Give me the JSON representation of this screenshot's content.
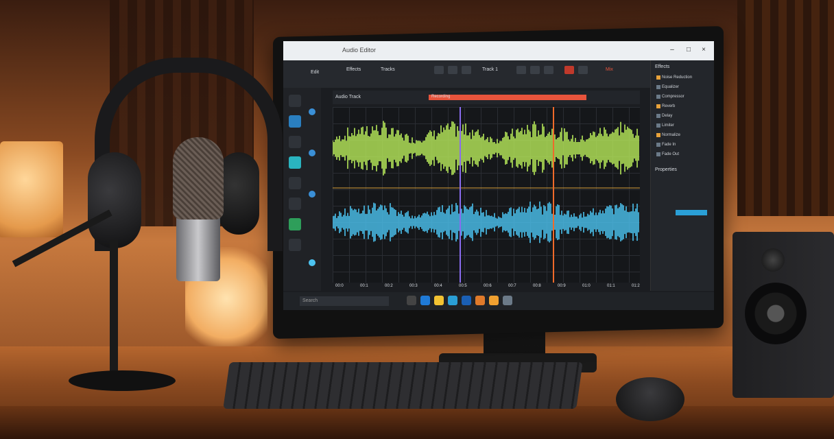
{
  "app": {
    "title": "Audio Editor",
    "toolbar_labels": [
      "Edit",
      "Effects",
      "Tracks",
      "Track 1",
      "Mix"
    ],
    "timeline_bar_label": "Recording",
    "track_label": "Audio Track",
    "right_panel_title": "Effects",
    "right_panel_items": [
      "Noise Reduction",
      "Equalizer",
      "Compressor",
      "Reverb",
      "Delay",
      "Limiter",
      "Normalize",
      "Fade In",
      "Fade Out"
    ],
    "right_panel_section": "Properties",
    "time_ticks": [
      "00:0",
      "00:1",
      "00:2",
      "00:3",
      "00:4",
      "00:5",
      "00:6",
      "00:7",
      "00:8",
      "00:9",
      "01:0",
      "01:1",
      "01:2"
    ],
    "search_placeholder": "Search"
  },
  "colors": {
    "track1_wave": "#b8ea5a",
    "track2_wave": "#4cc3f0",
    "playhead": "#8a6cf0",
    "marker": "#f06a2a",
    "timeline_bar": "#e8543c"
  },
  "scene": {
    "objects": [
      "headphones",
      "microphone",
      "monitor",
      "keyboard",
      "mouse",
      "speaker",
      "lamp"
    ]
  }
}
